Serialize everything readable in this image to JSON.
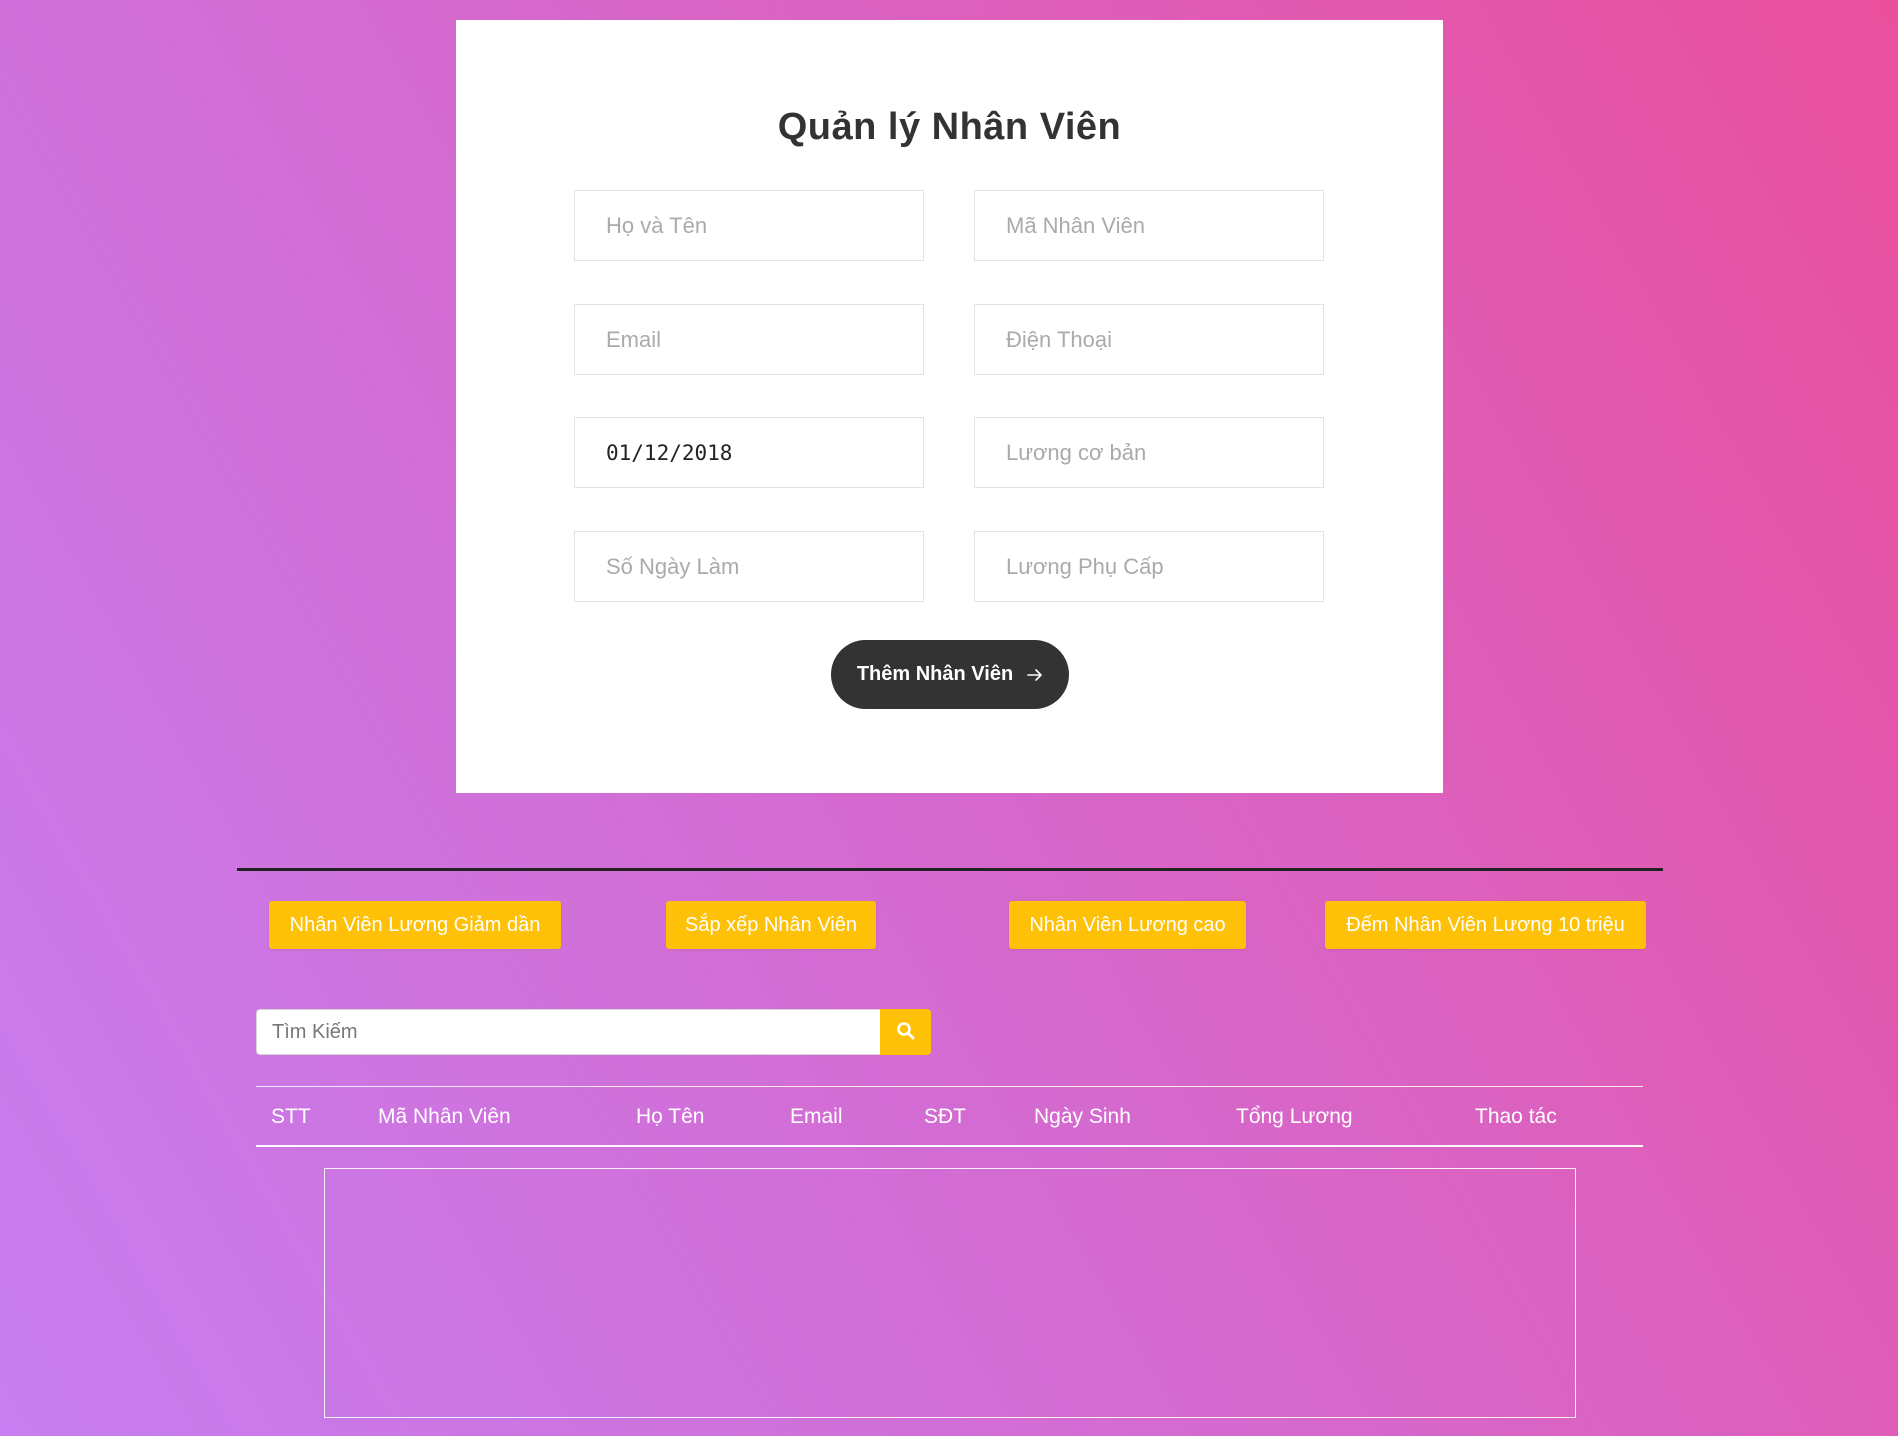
{
  "form": {
    "title": "Quản lý Nhân Viên",
    "fields": {
      "full_name": {
        "placeholder": "Họ và Tên",
        "value": ""
      },
      "employee_id": {
        "placeholder": "Mã Nhân Viên",
        "value": ""
      },
      "email": {
        "placeholder": "Email",
        "value": ""
      },
      "phone": {
        "placeholder": "Điện Thoại",
        "value": ""
      },
      "birth_date": {
        "placeholder": "",
        "value": "01/12/2018"
      },
      "base_salary": {
        "placeholder": "Lương cơ bản",
        "value": ""
      },
      "work_days": {
        "placeholder": "Số Ngày Làm",
        "value": ""
      },
      "allowance": {
        "placeholder": "Lương Phụ Cấp",
        "value": ""
      }
    },
    "submit_label": "Thêm Nhân Viên",
    "submit_icon": "arrow-right-icon"
  },
  "actions": [
    {
      "label": "Nhân Viên Lương Giảm dần"
    },
    {
      "label": "Sắp xếp Nhân Viên"
    },
    {
      "label": "Nhân Viên Lương cao"
    },
    {
      "label": "Đếm Nhân Viên Lương 10 triệu"
    }
  ],
  "search": {
    "placeholder": "Tìm Kiếm",
    "value": "",
    "icon": "search-icon"
  },
  "table": {
    "headers": [
      "STT",
      "Mã Nhân Viên",
      "Họ Tên",
      "Email",
      "SĐT",
      "Ngày Sinh",
      "Tổng Lương",
      "Thao tác"
    ],
    "rows": []
  },
  "colors": {
    "accent": "#ffc107",
    "dark": "#333333",
    "gradient_start": "#c77ef0",
    "gradient_end": "#ea4f9c"
  }
}
